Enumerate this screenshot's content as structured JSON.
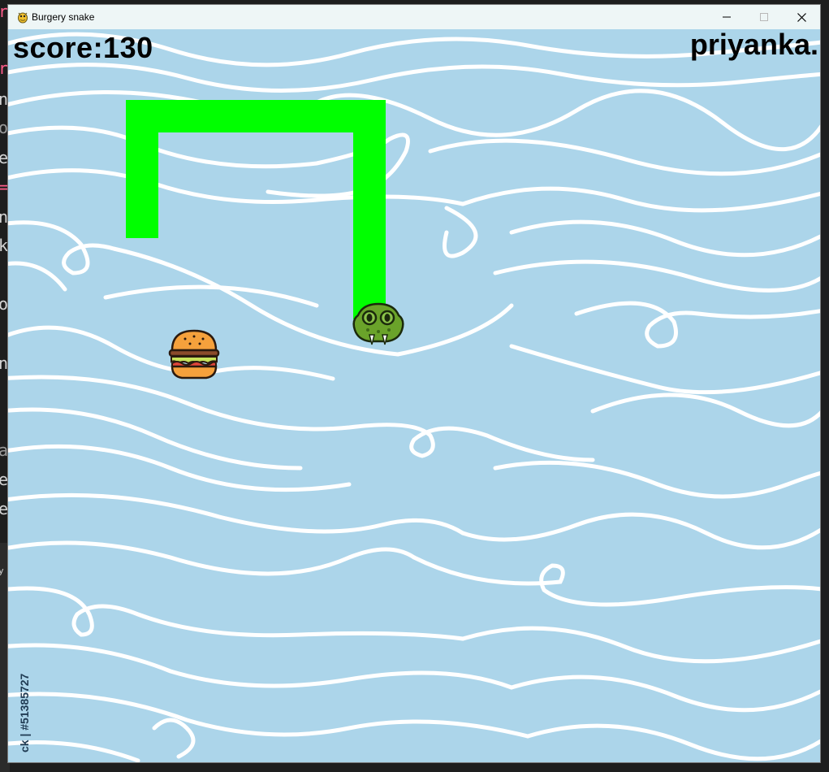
{
  "window": {
    "title": "Burgery snake",
    "controls": {
      "minimize_icon": "minimize-icon",
      "maximize_icon": "maximize-icon",
      "close_icon": "close-icon"
    }
  },
  "game": {
    "score_text": "score:130",
    "score": 130,
    "player_name": "priyanka.",
    "background_watermark_id": "ck | #51385727",
    "colors": {
      "background": "#acd5ea",
      "waves": "#ffffff",
      "snake_body": "#00ff00",
      "snake_head": "#6aa32a",
      "burger_bun": "#f5a13c",
      "text": "#000000"
    },
    "sprites": {
      "food": "burger-icon",
      "head": "snake-head-icon"
    }
  },
  "background_editor": {
    "glyphs": [
      "r",
      "r",
      "n",
      "o",
      "e",
      "=",
      "n",
      "k",
      "o",
      "n",
      "a",
      "e",
      "e",
      "y"
    ]
  }
}
